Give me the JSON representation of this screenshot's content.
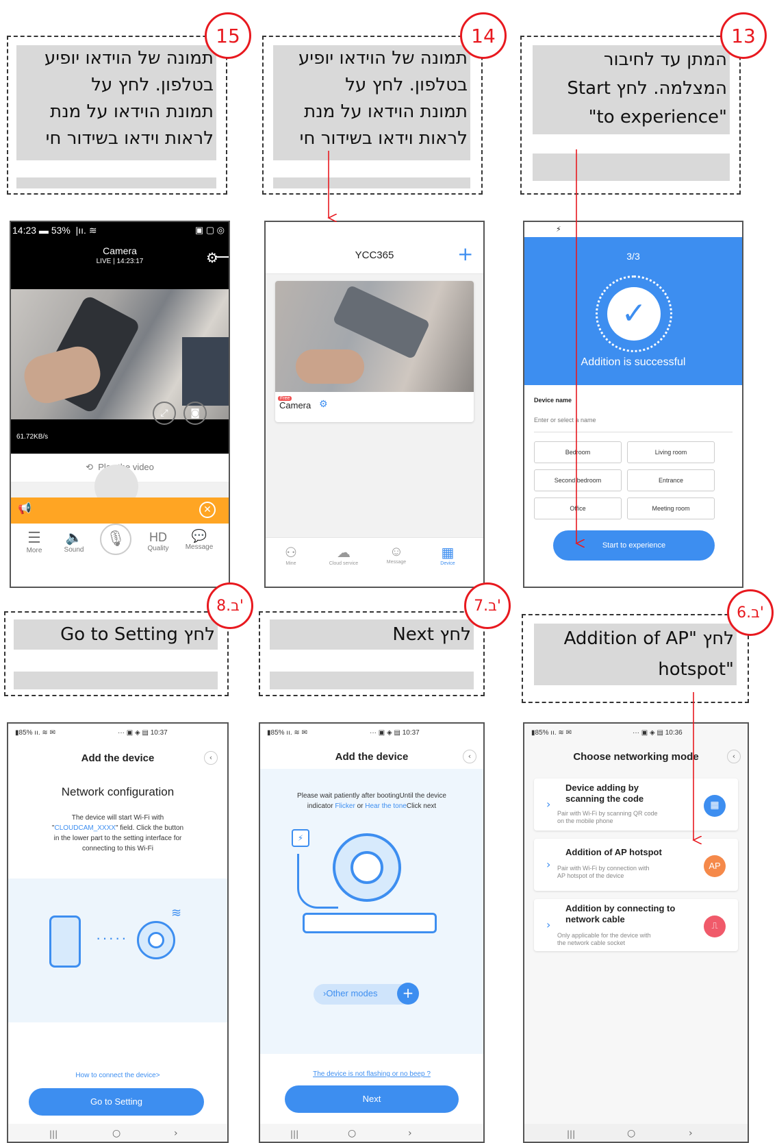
{
  "steps": {
    "s15": {
      "badge": "15",
      "text": [
        "תמונה של הוידאו יופיע",
        "בטלפון. לחץ על",
        "תמונת הוידאו על מנת",
        "לראות וידאו בשידור חי"
      ]
    },
    "s14": {
      "badge": "14",
      "text": [
        "תמונה של הוידאו יופיע",
        "בטלפון. לחץ על",
        "תמונת הוידאו על מנת",
        "לראות וידאו בשידור חי"
      ]
    },
    "s13": {
      "badge": "13",
      "text": [
        "המתן עד לחיבור",
        "המצלמה. לחץ  Start",
        "\"to experience\""
      ]
    },
    "s8b": {
      "badge": "8.ב'",
      "text": "לחץ Go to Setting"
    },
    "s7b": {
      "badge": "7.ב'",
      "text": "לחץ Next"
    },
    "s6b": {
      "badge": "6.ב'",
      "text": [
        "לחץ  \"Addition of AP",
        "\"hotspot"
      ]
    }
  },
  "live_view": {
    "status_time": "14:23",
    "status_battery": "53%",
    "title": "Camera",
    "subtitle": "LIVE | 14:23:17",
    "speed": "61.72KB/s",
    "play_label": "Play the video",
    "toolbar": {
      "more": "More",
      "sound": "Sound",
      "hd": "HD",
      "quality": "Quality",
      "message": "Message"
    },
    "colors": {
      "orange": "#ffa523"
    }
  },
  "device_list": {
    "title": "YCC365",
    "card_label": "Camera",
    "tag": "Free",
    "tabs": [
      "Mine",
      "Cloud service",
      "Message",
      "Device"
    ]
  },
  "success": {
    "step": "3/3",
    "status": "Addition is successful",
    "name_label": "Device name",
    "name_placeholder": "Enter or select a name",
    "rooms": [
      "Bedroom",
      "Living room",
      "Second bedroom",
      "Entrance",
      "Office",
      "Meeting room"
    ],
    "start_button": "Start to experience",
    "colors": {
      "blue": "#3d8ef0"
    }
  },
  "network_config": {
    "status_left": "85%",
    "status_time": "10:37",
    "title": "Add the device",
    "heading": "Network configuration",
    "desc_1": "The device will start Wi-Fi with",
    "desc_2a": "\"",
    "desc_2_link": "CLOUDCAM_XXXX",
    "desc_2b": "\" field. Click the button",
    "desc_3": "in the lower part to the setting interface for",
    "desc_4": "connecting to this Wi-Fi",
    "dots": "·····",
    "help_link": "How to connect the device>",
    "button": "Go to Setting"
  },
  "add_device": {
    "status_left": "85%",
    "status_time": "10:37",
    "title": "Add the device",
    "desc_1": "Please wait patiently after bootingUntil the device",
    "desc_2a": "indicator ",
    "desc_2_link1": "Flicker",
    "desc_2b": " or ",
    "desc_2_link2": "Hear the tone",
    "desc_2c": "Click next",
    "other_modes": "›Other modes",
    "help_link": "The device is not flashing or no beep ?",
    "button": "Next"
  },
  "networking_mode": {
    "status_left": "85%",
    "status_time": "10:36",
    "title": "Choose networking mode",
    "options": [
      {
        "title_1": "Device adding by",
        "title_2": "scanning the code",
        "desc_1": "Pair with Wi-Fi by scanning QR code",
        "desc_2": "on the mobile phone",
        "badge": ""
      },
      {
        "title_1": "Addition of AP hotspot",
        "title_2": "",
        "desc_1": "Pair with Wi-Fi by connection with",
        "desc_2": "AP hotspot of the device",
        "badge": "AP"
      },
      {
        "title_1": "Addition by connecting to",
        "title_2": "network cable",
        "desc_1": "Only applicable for the device with",
        "desc_2": "the network cable socket",
        "badge": ""
      }
    ]
  }
}
